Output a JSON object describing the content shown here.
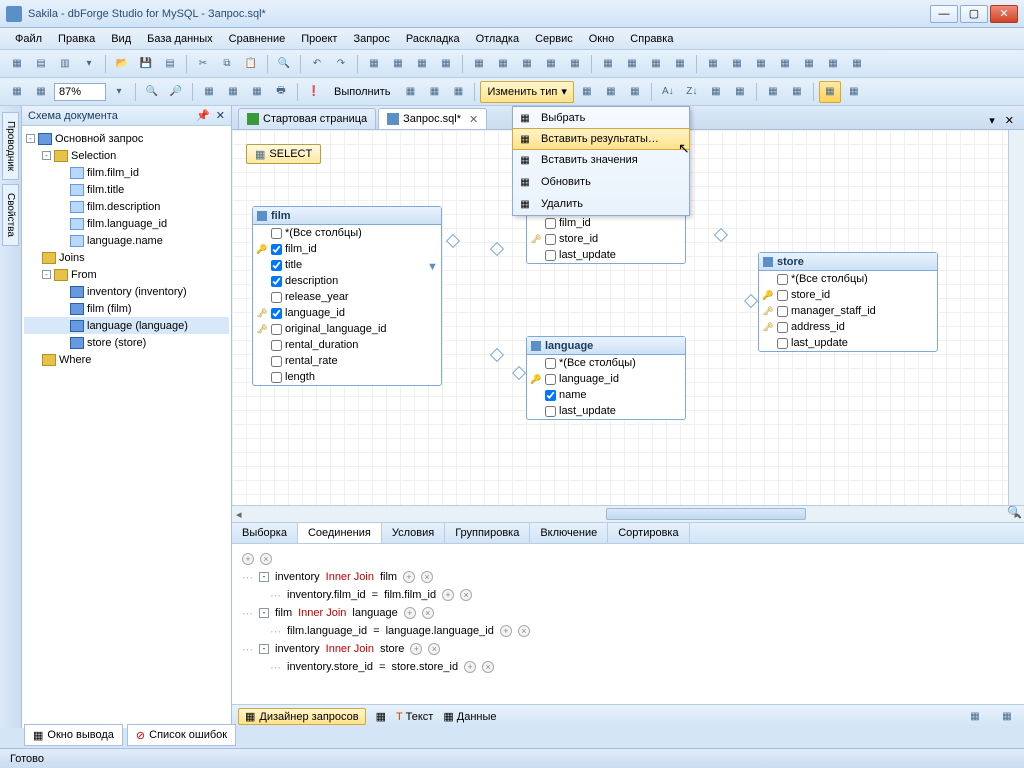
{
  "window": {
    "title": "Sakila - dbForge Studio for MySQL - Запрос.sql*"
  },
  "menu": [
    "Файл",
    "Правка",
    "Вид",
    "База данных",
    "Сравнение",
    "Проект",
    "Запрос",
    "Раскладка",
    "Отладка",
    "Сервис",
    "Окно",
    "Справка"
  ],
  "toolbar2": {
    "zoom": "87%",
    "execute": "Выполнить",
    "change_type": "Изменить тип"
  },
  "dropdown": {
    "items": [
      {
        "icon": "select-icon",
        "label": "Выбрать"
      },
      {
        "icon": "insert-results-icon",
        "label": "Вставить результаты…",
        "hover": true
      },
      {
        "icon": "insert-values-icon",
        "label": "Вставить значения"
      },
      {
        "icon": "update-icon",
        "label": "Обновить"
      },
      {
        "icon": "delete-icon",
        "label": "Удалить"
      }
    ]
  },
  "side_tabs": [
    "Проводник",
    "Свойства"
  ],
  "outline": {
    "title": "Схема документа",
    "root": "Основной запрос",
    "groups": [
      {
        "name": "Selection",
        "items": [
          "film.film_id",
          "film.title",
          "film.description",
          "film.language_id",
          "language.name"
        ]
      },
      {
        "name": "Joins",
        "items": []
      },
      {
        "name": "From",
        "items": [
          "inventory (inventory)",
          "film (film)",
          "language (language)",
          "store (store)"
        ],
        "selected": "language (language)"
      },
      {
        "name": "Where",
        "items": []
      }
    ]
  },
  "editor_tabs": [
    {
      "label": "Стартовая страница",
      "icon": "start-page-icon"
    },
    {
      "label": "Запрос.sql*",
      "icon": "sql-file-icon",
      "active": true
    }
  ],
  "select_chip": "SELECT",
  "tables": {
    "film": {
      "title": "film",
      "columns": [
        {
          "key": "",
          "chk": false,
          "name": "*(Все столбцы)"
        },
        {
          "key": "pk",
          "chk": true,
          "name": "film_id"
        },
        {
          "key": "",
          "chk": true,
          "name": "title"
        },
        {
          "key": "",
          "chk": true,
          "name": "description"
        },
        {
          "key": "",
          "chk": false,
          "name": "release_year"
        },
        {
          "key": "fk",
          "chk": true,
          "name": "language_id"
        },
        {
          "key": "fk",
          "chk": false,
          "name": "original_language_id"
        },
        {
          "key": "",
          "chk": false,
          "name": "rental_duration"
        },
        {
          "key": "",
          "chk": false,
          "name": "rental_rate"
        },
        {
          "key": "",
          "chk": false,
          "name": "length"
        }
      ]
    },
    "inventory_partial": {
      "columns": [
        {
          "key": "",
          "chk": false,
          "name": "film_id"
        },
        {
          "key": "fk",
          "chk": false,
          "name": "store_id"
        },
        {
          "key": "",
          "chk": false,
          "name": "last_update"
        }
      ]
    },
    "language": {
      "title": "language",
      "columns": [
        {
          "key": "",
          "chk": false,
          "name": "*(Все столбцы)"
        },
        {
          "key": "pk",
          "chk": false,
          "name": "language_id"
        },
        {
          "key": "",
          "chk": true,
          "name": "name"
        },
        {
          "key": "",
          "chk": false,
          "name": "last_update"
        }
      ]
    },
    "store": {
      "title": "store",
      "columns": [
        {
          "key": "",
          "chk": false,
          "name": "*(Все столбцы)"
        },
        {
          "key": "pk",
          "chk": false,
          "name": "store_id"
        },
        {
          "key": "fk",
          "chk": false,
          "name": "manager_staff_id"
        },
        {
          "key": "fk",
          "chk": false,
          "name": "address_id"
        },
        {
          "key": "",
          "chk": false,
          "name": "last_update"
        }
      ]
    }
  },
  "qtabs": [
    "Выборка",
    "Соединения",
    "Условия",
    "Группировка",
    "Включение",
    "Сортировка"
  ],
  "qtabs_active": "Соединения",
  "joins": [
    {
      "left": "inventory",
      "kw": "Inner Join",
      "right": "film",
      "cond": {
        "l": "inventory.film_id",
        "op": "=",
        "r": "film.film_id"
      }
    },
    {
      "left": "film",
      "kw": "Inner Join",
      "right": "language",
      "cond": {
        "l": "film.language_id",
        "op": "=",
        "r": "language.language_id"
      }
    },
    {
      "left": "inventory",
      "kw": "Inner Join",
      "right": "store",
      "cond": {
        "l": "inventory.store_id",
        "op": "=",
        "r": "store.store_id"
      }
    }
  ],
  "view_bar": {
    "designer": "Дизайнер запросов",
    "text": "Текст",
    "data": "Данные"
  },
  "bottom_tabs": [
    "Окно вывода",
    "Список ошибок"
  ],
  "status": "Готово"
}
